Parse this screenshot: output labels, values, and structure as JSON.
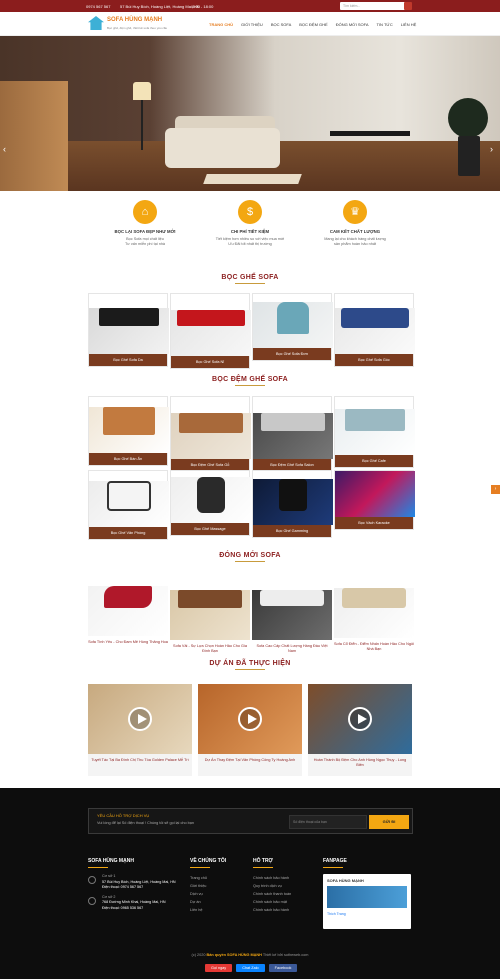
{
  "topbar": {
    "phone": "0974 567 567",
    "address": "57 Bùi Huy Bích, Hoàng Liệt, Hoàng Mai, HN",
    "hours": "8:00 - 18:00",
    "search_placeholder": "Tìm kiếm..."
  },
  "header": {
    "brand": "SOFA HÙNG MẠNH",
    "tagline": "Bọc ghế, đệm ghế, thiết kế sofa theo yêu cầu",
    "nav": [
      "TRANG CHỦ",
      "GIỚI THIỆU",
      "BỌC SOFA",
      "BỌC ĐỆM GHẾ",
      "ĐÓNG MỚI SOFA",
      "TIN TỨC",
      "LIÊN HỆ"
    ]
  },
  "features": [
    {
      "title": "BỌC LẠI SOFA ĐẸP NHƯ MỚI",
      "desc": "Bọc Sofa mọi chất liệu\nTư vấn miễn phí tại nhà",
      "icon": "sofa-icon"
    },
    {
      "title": "CHI PHÍ TIẾT KIỆM",
      "desc": "Tiết kiệm hơn nhiều so với việc mua mới\nƯu Đãi tốt nhất thị trường",
      "icon": "coin-icon"
    },
    {
      "title": "CAM KẾT CHẤT LƯỢNG",
      "desc": "Mang lại cho khách hàng chất lượng\nsản phẩm hoàn hảo nhất",
      "icon": "crown-icon"
    }
  ],
  "sections": {
    "boc_sofa": "BỌC GHẾ SOFA",
    "boc_dem": "BỌC ĐỆM GHẾ SOFA",
    "dong_moi": "ĐÓNG MỚI SOFA",
    "du_an": "DỰ ÁN ĐÃ THỰC HIỆN"
  },
  "boc_sofa": [
    "Bọc Ghế Sofa Da",
    "Bọc Ghế Sofa Nỉ",
    "Bọc Ghế Sofa Đơn",
    "Bọc Ghế Sofa Góc"
  ],
  "boc_dem": [
    "Bọc Ghế Bàn Ăn",
    "Bọc Đệm Ghế Sofa Gỗ",
    "Bọc Đệm Ghế Sofa Salon",
    "Bọc Ghế Cafe",
    "Bọc Ghế Văn Phòng",
    "Bọc Ghế Massage",
    "Bọc Ghế Gamming",
    "Bọc Vách Karaoke"
  ],
  "dong_moi": [
    "Sofa Tình Yêu - Cho Đam Mê Hùng Thăng Hoa",
    "Sofa Vải - Sự Lựa Chọn Hoàn Hảo Cho Gia Đình Bạn",
    "Sofa Cao Cấp Chất Lượng Hàng Đầu Việt Nam",
    "Sofa Cổ Điển - Điểm Nhấn Hoàn Hảo Cho Ngôi Nhà Bạn"
  ],
  "du_an": [
    "Tuyết Tác Tại Ba Đình Chị Thu Tòa Golden Palace Mễ Trì",
    "Dự Án Thay Đệm Tại Văn Phòng Công Ty Hoàng Anh",
    "Hoàn Thành Bộ Đệm Cho Anh Hùng Ngọc Thụy - Long Biên"
  ],
  "newsletter": {
    "title": "YÊU CẦU HỖ TRỢ DỊCH VỤ",
    "desc": "Vui lòng để lại Số điện thoại ! Chúng tôi sẽ gọi lại cho bạn",
    "placeholder": "Số điện thoại của bạn",
    "button": "GỬI ĐI"
  },
  "footer": {
    "col1_title": "SOFA HÙNG MẠNH",
    "offices": [
      {
        "name": "Cơ sở 1",
        "addr": "57 Bùi Huy Bích, Hoàng Liệt, Hoàng Mai, HN",
        "phone": "Điện thoại: 0974 567 567"
      },
      {
        "name": "Cơ sở 2",
        "addr": "768 Đường Minh Khai, Hoàng Mai, HN",
        "phone": "Điện thoại: 0965 536 567"
      }
    ],
    "col2_title": "VỀ CHÚNG TÔI",
    "col2_items": [
      "Trang chủ",
      "Giới thiệu",
      "Dịch vụ",
      "Dự án",
      "Liên hệ"
    ],
    "col3_title": "HỖ TRỢ",
    "col3_items": [
      "Chính sách bảo hành",
      "Quy trình dịch vụ",
      "Chính sách thanh toán",
      "Chính sách bảo mật",
      "Chính sách bảo hành"
    ],
    "col4_title": "FANPAGE",
    "fan_name": "SOFA HÙNG MẠNH",
    "fan_like": "Thích Trang",
    "copyright_pre": "(c) 2020",
    "copyright_brand": "Bản quyền SOFA HÙNG MẠNH",
    "copyright_post": "Thiết kế bởi sotheweb.com",
    "btn_call": "Gọi ngay",
    "btn_zalo": "Chat Zalo",
    "btn_fb": "Facebook"
  }
}
